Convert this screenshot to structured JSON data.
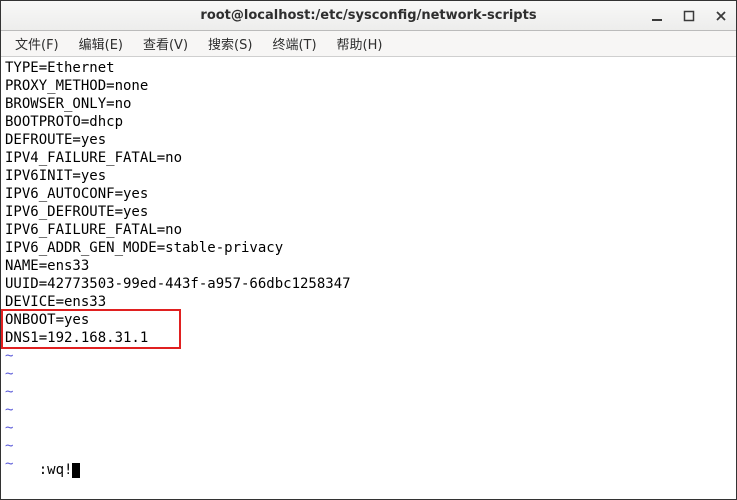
{
  "window": {
    "title": "root@localhost:/etc/sysconfig/network-scripts"
  },
  "menu": {
    "file": "文件(F)",
    "edit": "编辑(E)",
    "view": "查看(V)",
    "search": "搜索(S)",
    "terminal": "终端(T)",
    "help": "帮助(H)"
  },
  "file_lines": [
    "TYPE=Ethernet",
    "PROXY_METHOD=none",
    "BROWSER_ONLY=no",
    "BOOTPROTO=dhcp",
    "DEFROUTE=yes",
    "IPV4_FAILURE_FATAL=no",
    "IPV6INIT=yes",
    "IPV6_AUTOCONF=yes",
    "IPV6_DEFROUTE=yes",
    "IPV6_FAILURE_FATAL=no",
    "IPV6_ADDR_GEN_MODE=stable-privacy",
    "NAME=ens33",
    "UUID=42773503-99ed-443f-a957-66dbc1258347",
    "DEVICE=ens33",
    "ONBOOT=yes",
    "DNS1=192.168.31.1"
  ],
  "tilde": "~",
  "command_line": ":wq!",
  "annotation": {
    "highlighted_keys": [
      "ONBOOT",
      "DNS1"
    ],
    "color": "#e02020"
  }
}
